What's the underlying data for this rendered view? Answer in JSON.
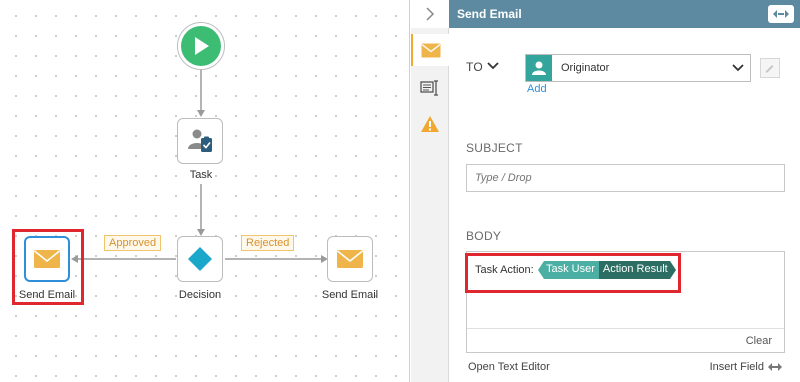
{
  "canvas": {
    "nodes": {
      "task_label": "Task",
      "decision_label": "Decision",
      "send_email_left_label": "Send Email",
      "send_email_right_label": "Send Email"
    },
    "paths": {
      "approved": "Approved",
      "rejected": "Rejected"
    }
  },
  "panel": {
    "title": "Send Email",
    "to": {
      "label": "TO",
      "recipient": "Originator",
      "add_link": "Add"
    },
    "subject": {
      "label": "SUBJECT",
      "placeholder": "Type / Drop"
    },
    "body": {
      "label": "BODY",
      "task_action_label": "Task Action:",
      "token_user": "Task User",
      "token_result": "Action Result",
      "clear": "Clear"
    },
    "footer": {
      "open_text_editor": "Open Text Editor",
      "insert_field": "Insert Field"
    }
  },
  "colors": {
    "accent": "#2f8fd8",
    "header": "#5d8aa0",
    "start": "#3dbc73",
    "decision": "#1aa7c9",
    "email": "#f0b54a",
    "highlight": "#e0262e",
    "token_user": "#4bb0a3",
    "token_result": "#2c6e63"
  }
}
